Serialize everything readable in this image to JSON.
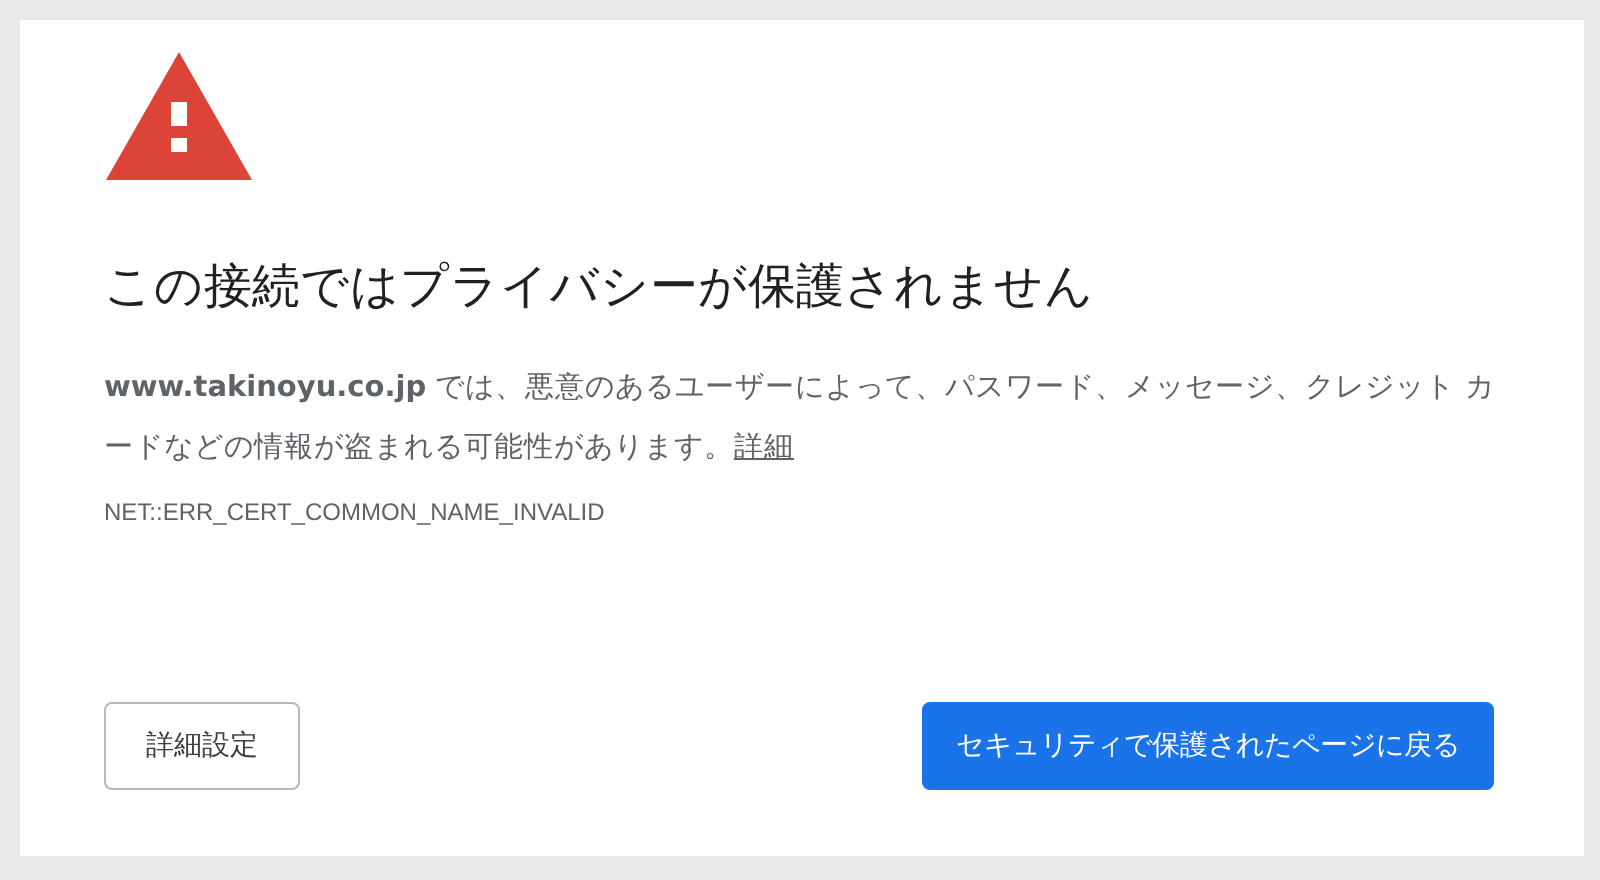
{
  "title": "この接続ではプライバシーが保護されません",
  "description": "**www.takinoyu.co.jp** では、悪意のあるユーザーによって、パスワード、メッセージ、クレジット カードなどの情報が盗まれる可能性があります。",
  "details_link": "詳細",
  "error_code": "NET::ERR_CERT_COMMON_NAME_INVALID",
  "buttons": [
    {
      "label": "詳細設定",
      "kind": "secondary"
    },
    {
      "label": "セキュリティで保護されたページに戻る",
      "kind": "primary"
    }
  ]
}
